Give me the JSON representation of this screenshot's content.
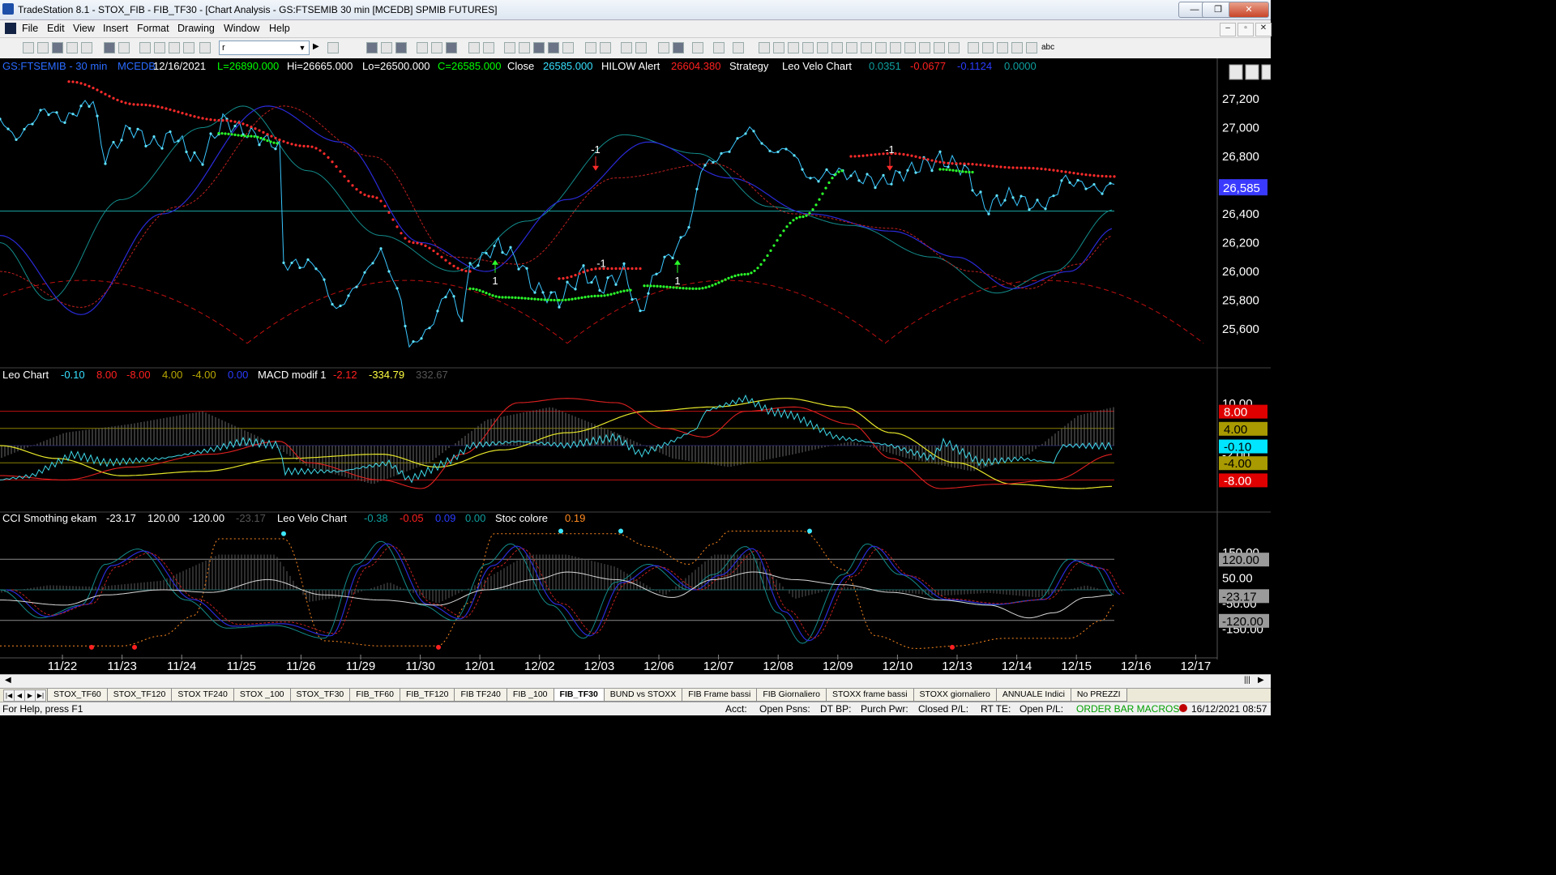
{
  "window": {
    "title": "TradeStation 8.1 - STOX_FIB - FIB_TF30 - [Chart Analysis - GS:FTSEMIB  30 min  [MCEDB] SPMIB FUTURES]",
    "minimize": "—",
    "restore": "❐",
    "close": "✕"
  },
  "menu": [
    "File",
    "Edit",
    "View",
    "Insert",
    "Format",
    "Drawing",
    "Window",
    "Help"
  ],
  "toolbar": {
    "symbol_combo": "r",
    "abc_label": "abc"
  },
  "chart": {
    "header": [
      {
        "text": "GS:FTSEMIB - 30 min",
        "color": "#2a6bff"
      },
      {
        "text": "MCEDB",
        "color": "#2a6bff"
      },
      {
        "text": "12/16/2021",
        "color": "#ffffff"
      },
      {
        "text": "L=26890.000",
        "color": "#00ff00"
      },
      {
        "text": "Hi=26665.000",
        "color": "#ffffff"
      },
      {
        "text": "Lo=26500.000",
        "color": "#ffffff"
      },
      {
        "text": "C=26585.000",
        "color": "#00ff00"
      },
      {
        "text": "Close",
        "color": "#ffffff"
      },
      {
        "text": "26585.000",
        "color": "#36e0ff"
      },
      {
        "text": "HILOW Alert",
        "color": "#ffffff"
      },
      {
        "text": "26604.380",
        "color": "#ff2020"
      },
      {
        "text": "Strategy",
        "color": "#ffffff"
      },
      {
        "text": "Leo Velo Chart",
        "color": "#ffffff"
      },
      {
        "text": "0.0351",
        "color": "#0f9f9f"
      },
      {
        "text": "-0.0677",
        "color": "#ff2020"
      },
      {
        "text": "-0.1124",
        "color": "#2a3cff"
      },
      {
        "text": "0.0000",
        "color": "#0f9f9f"
      }
    ],
    "pane2_header": [
      {
        "text": "Leo Chart",
        "color": "#ffffff"
      },
      {
        "text": "-0.10",
        "color": "#36e0ff"
      },
      {
        "text": "8.00",
        "color": "#ff2020"
      },
      {
        "text": "-8.00",
        "color": "#ff2020"
      },
      {
        "text": "4.00",
        "color": "#b8a800"
      },
      {
        "text": "-4.00",
        "color": "#b8a800"
      },
      {
        "text": "0.00",
        "color": "#2a3cff"
      },
      {
        "text": "MACD modif 1",
        "color": "#ffffff"
      },
      {
        "text": "-2.12",
        "color": "#ff2020"
      },
      {
        "text": "-334.79",
        "color": "#ffff40"
      },
      {
        "text": "332.67",
        "color": "#555555"
      }
    ],
    "pane3_header": [
      {
        "text": "CCI Smothing ekam",
        "color": "#ffffff"
      },
      {
        "text": "-23.17",
        "color": "#ffffff"
      },
      {
        "text": "120.00",
        "color": "#ffffff"
      },
      {
        "text": "-120.00",
        "color": "#ffffff"
      },
      {
        "text": "-23.17",
        "color": "#555555"
      },
      {
        "text": "Leo Velo Chart",
        "color": "#ffffff"
      },
      {
        "text": "-0.38",
        "color": "#0f9f9f"
      },
      {
        "text": "-0.05",
        "color": "#ff2020"
      },
      {
        "text": "0.09",
        "color": "#2a3cff"
      },
      {
        "text": "0.00",
        "color": "#0f9f9f"
      },
      {
        "text": "Stoc colore",
        "color": "#ffffff"
      },
      {
        "text": "0.19",
        "color": "#ff8a20"
      }
    ],
    "price_axis": [
      "27,200",
      "27,000",
      "26,800",
      "26,600",
      "26,400",
      "26,200",
      "26,000",
      "25,800",
      "25,600"
    ],
    "last_price": "26,585",
    "pane2_axis": [
      "10.00",
      "-2.00"
    ],
    "pane2_markers": [
      {
        "text": "8.00",
        "bg": "#e00000",
        "fg": "#ffffff"
      },
      {
        "text": "4.00",
        "bg": "#a89a00",
        "fg": "#000000"
      },
      {
        "text": "-0.10",
        "bg": "#00e5ff",
        "fg": "#000000"
      },
      {
        "text": "-4.00",
        "bg": "#a89a00",
        "fg": "#000000"
      },
      {
        "text": "-8.00",
        "bg": "#e00000",
        "fg": "#ffffff"
      }
    ],
    "pane3_axis": [
      "150.00",
      "50.00",
      "-50.00",
      "-150.00"
    ],
    "pane3_markers": [
      {
        "text": "120.00",
        "bg": "#9a9a9a",
        "fg": "#000000"
      },
      {
        "text": "-23.17",
        "bg": "#9a9a9a",
        "fg": "#000000"
      },
      {
        "text": "-120.00",
        "bg": "#9a9a9a",
        "fg": "#000000"
      }
    ],
    "dates": [
      "11/22",
      "11/23",
      "11/24",
      "11/25",
      "11/26",
      "11/29",
      "11/30",
      "12/01",
      "12/02",
      "12/03",
      "12/06",
      "12/07",
      "12/08",
      "12/09",
      "12/10",
      "12/13",
      "12/14",
      "12/15",
      "12/16",
      "12/17"
    ],
    "annotations": [
      "1",
      "-1",
      "1",
      "-1",
      "1",
      "-1"
    ]
  },
  "tabs": [
    "STOX_TF60",
    "STOX_TF120",
    "STOX TF240",
    "STOX _100",
    "STOX_TF30",
    "FIB_TF60",
    "FIB_TF120",
    "FIB TF240",
    "FIB _100",
    "FIB_TF30",
    "BUND vs STOXX",
    "FIB Frame bassi",
    "FIB Giornaliero",
    "STOXX frame bassi",
    "STOXX giornaliero",
    "ANNUALE Indici",
    "No PREZZI"
  ],
  "active_tab": "FIB_TF30",
  "status": {
    "help": "For Help, press F1",
    "acct": "Acct:",
    "open_psns": "Open Psns:",
    "dt_bp": "DT BP:",
    "purch_pwr": "Purch Pwr:",
    "closed_pl": "Closed P/L:",
    "rt_te": "RT TE:",
    "open_pl": "Open P/L:",
    "macros": "ORDER BAR  MACROS",
    "datetime": "16/12/2021 08:57"
  }
}
